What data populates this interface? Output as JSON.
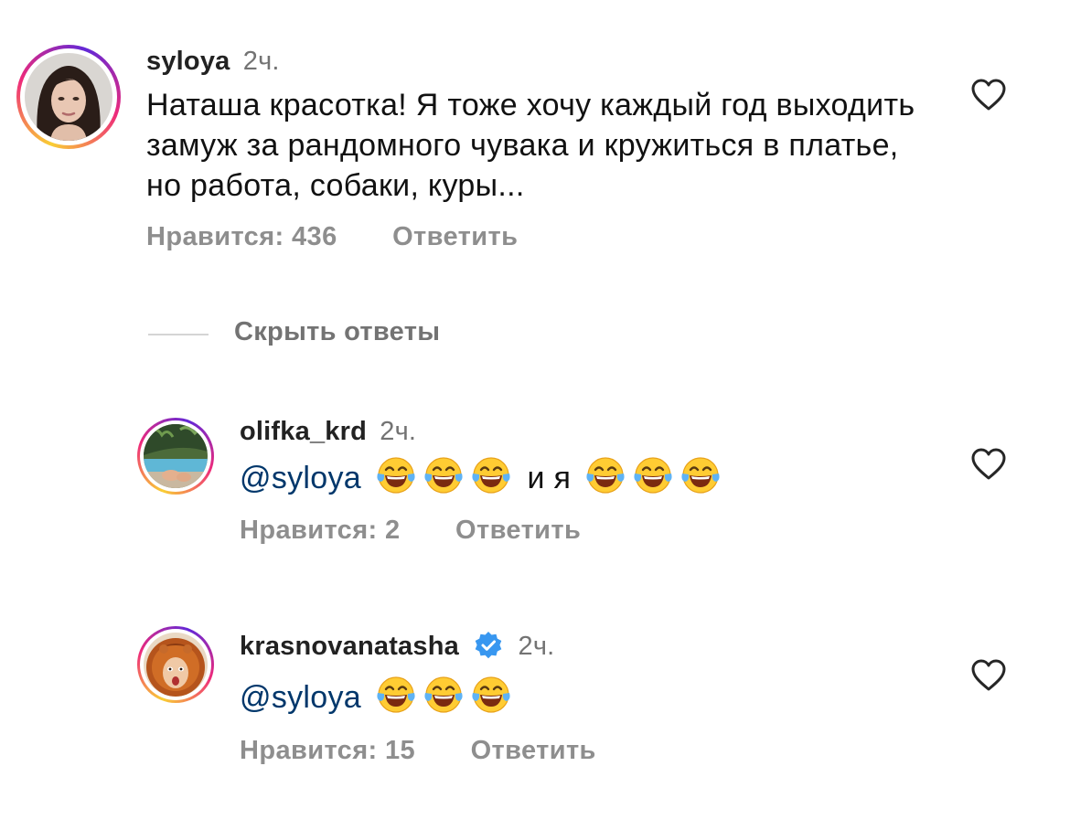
{
  "comments": [
    {
      "username": "syloya",
      "time": "2ч.",
      "text": "Наташа красотка! Я тоже хочу каждый год выходить замуж за рандомного чувака и кружиться в платье, но работа, собаки, куры...",
      "likes_label": "Нравится: 436",
      "reply_label": "Ответить",
      "avatar_icon": "woman-portrait"
    }
  ],
  "replies_toggle": "Скрыть ответы",
  "replies": [
    {
      "username": "olifka_krd",
      "time": "2ч.",
      "mention": "@syloya",
      "middle_text": "и я",
      "emoji_before": 3,
      "emoji_after": 3,
      "emoji_icon": "face-with-tears-of-joy",
      "likes_label": "Нравится: 2",
      "reply_label": "Ответить",
      "avatar_icon": "pool-garden"
    },
    {
      "username": "krasnovanatasha",
      "verified": true,
      "time": "2ч.",
      "mention": "@syloya",
      "emoji_count": 3,
      "emoji_icon": "face-with-tears-of-joy",
      "likes_label": "Нравится: 15",
      "reply_label": "Ответить",
      "avatar_icon": "lion-costume"
    }
  ],
  "colors": {
    "mention": "#00376b",
    "muted": "#8e8e8e",
    "verified": "#3897f0"
  }
}
